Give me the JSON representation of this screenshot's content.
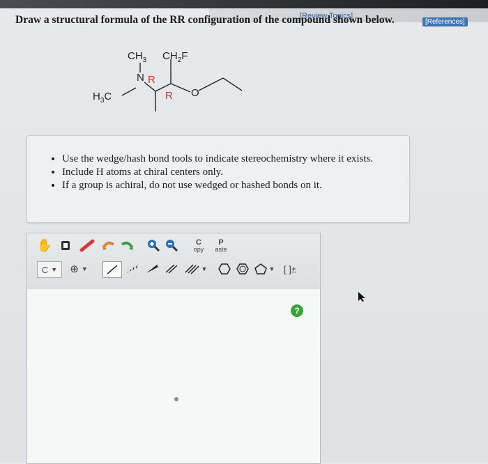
{
  "header": {
    "review_topics": "[Review Topics]",
    "references": "[References]"
  },
  "question": {
    "prompt": "Draw a structural formula of the RR configuration of the compound shown below."
  },
  "molecule": {
    "ch3": "CH",
    "ch3_sub": "3",
    "ch2f_a": "CH",
    "ch2f_sub": "2",
    "ch2f_b": "F",
    "n": "N",
    "r1": "R",
    "r2": "R",
    "o": "O",
    "h3c_a": "H",
    "h3c_sub": "3",
    "h3c_b": "C"
  },
  "instructions": {
    "items": [
      "Use the wedge/hash bond tools to indicate stereochemistry where it exists.",
      "Include H atoms at chiral centers only.",
      "If a group is achiral, do not use wedged or hashed bonds on it."
    ]
  },
  "toolbar": {
    "copy_top": "C",
    "copy_bottom": "opy",
    "paste_top": "P",
    "paste_bottom": "aste",
    "element": "C",
    "bracket": "[ ]±",
    "help": "?"
  },
  "colors": {
    "accent": "#3f74b3",
    "stereo_label": "#c0392b",
    "help_green": "#3aa33a"
  }
}
